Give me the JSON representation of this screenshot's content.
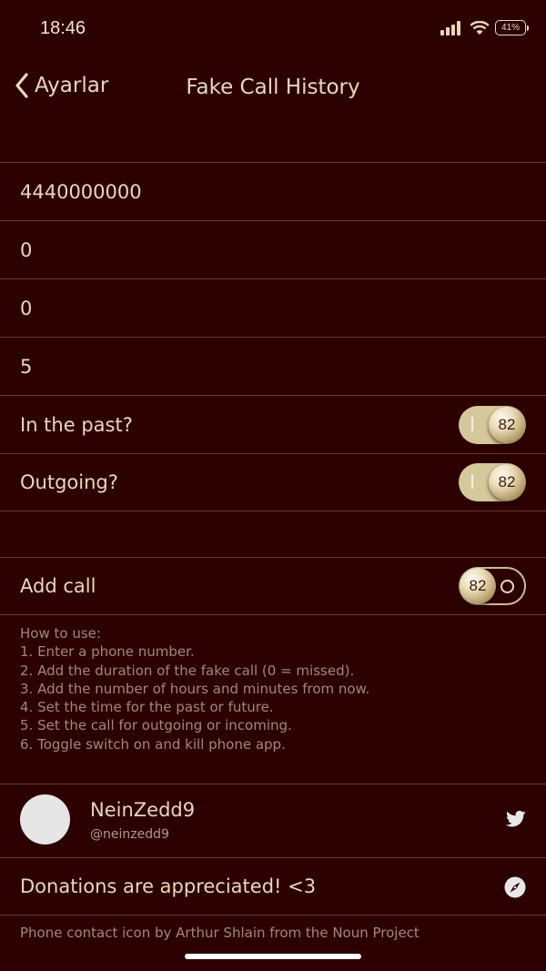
{
  "status": {
    "time": "18:46",
    "battery": "41%"
  },
  "nav": {
    "back_label": "Ayarlar",
    "title": "Fake Call History"
  },
  "fields": [
    {
      "value": "4440000000"
    },
    {
      "value": "0"
    },
    {
      "value": "0"
    },
    {
      "value": "5"
    }
  ],
  "toggles": {
    "past": {
      "label": "In the past?",
      "state": "on",
      "knob_text": "82"
    },
    "outgoing": {
      "label": "Outgoing?",
      "state": "on",
      "knob_text": "82"
    },
    "add_call": {
      "label": "Add call",
      "state": "off",
      "knob_text": "82"
    }
  },
  "howto": {
    "heading": "How to use:",
    "steps": [
      "1. Enter a phone number.",
      "2. Add the duration of the fake call (0 = missed).",
      "3. Add the number of hours and minutes from now.",
      "4. Set the time for the past or future.",
      "5. Set the call for outgoing or incoming.",
      "6. Toggle switch on and kill phone app."
    ]
  },
  "profile": {
    "name": "NeinZedd9",
    "handle": "@neinzedd9",
    "icon": "twitter-icon"
  },
  "donate": {
    "label": "Donations are appreciated! <3",
    "icon": "compass-icon"
  },
  "credit": "Phone contact icon by Arthur Shlain from the Noun Project",
  "colors": {
    "background": "#2d0000",
    "text": "#e8d9b8",
    "toggle_on": "#d5c89a"
  }
}
